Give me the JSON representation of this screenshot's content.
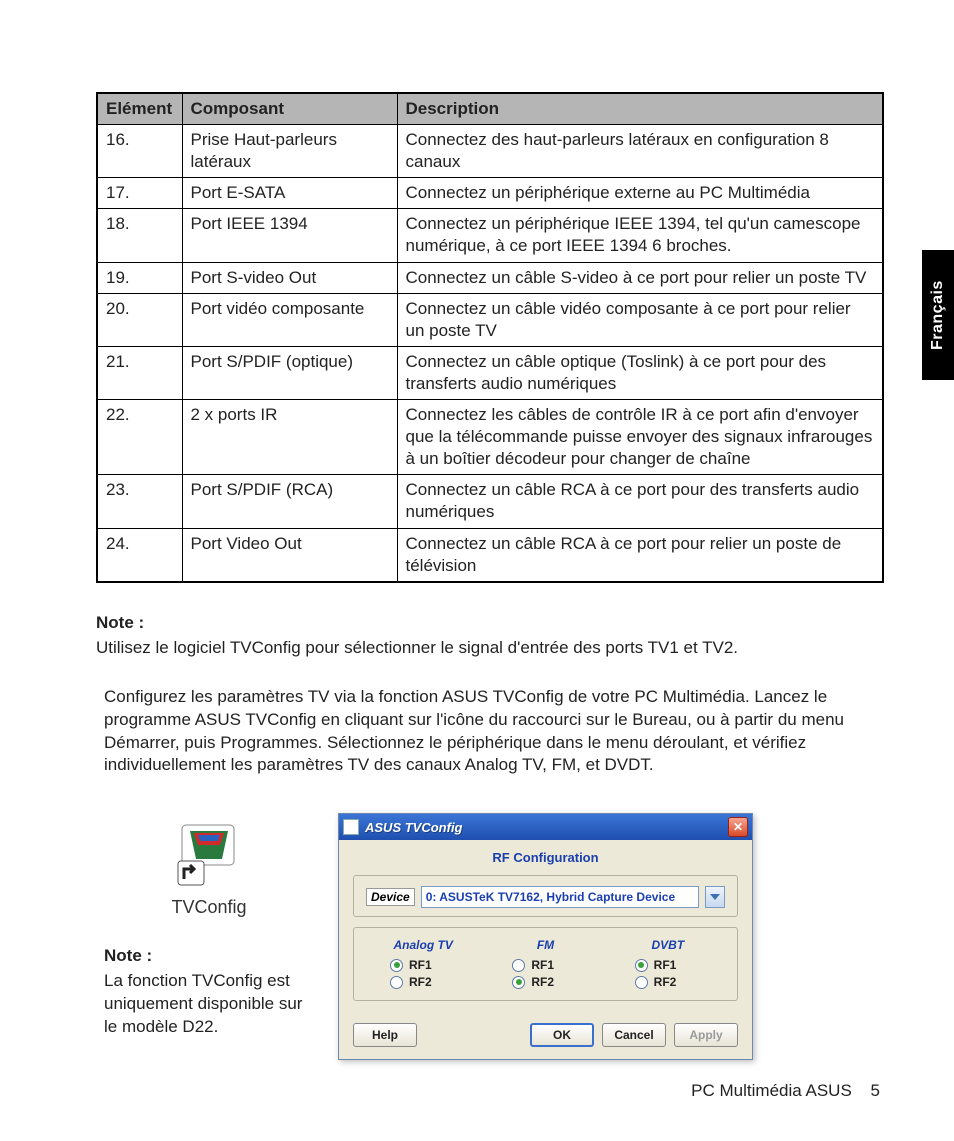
{
  "sideTab": "Français",
  "table": {
    "headers": {
      "c1": "Elément",
      "c2": "Composant",
      "c3": "Description"
    },
    "rows": [
      {
        "n": "16.",
        "comp": "Prise Haut-parleurs latéraux",
        "desc": "Connectez des haut-parleurs latéraux en configuration 8 canaux"
      },
      {
        "n": "17.",
        "comp": "Port E-SATA",
        "desc": "Connectez un périphérique externe au PC Multimédia"
      },
      {
        "n": "18.",
        "comp": "Port IEEE 1394",
        "desc": "Connectez un périphérique IEEE 1394, tel qu'un camescope numérique,  à ce port IEEE 1394 6 broches."
      },
      {
        "n": "19.",
        "comp": "Port S-video Out",
        "desc": "Connectez un câble S-video à ce port pour relier un poste TV"
      },
      {
        "n": "20.",
        "comp": "Port vidéo composante",
        "desc": "Connectez un câble vidéo composante à ce port pour relier un poste TV"
      },
      {
        "n": "21.",
        "comp": "Port S/PDIF (optique)",
        "desc": "Connectez un câble optique (Toslink) à ce port pour des transferts audio numériques"
      },
      {
        "n": "22.",
        "comp": "2 x ports IR",
        "desc": "Connectez les câbles de contrôle IR à ce port afin d'envoyer que la télécommande puisse envoyer des signaux infrarouges à un boîtier décodeur pour changer de chaîne"
      },
      {
        "n": "23.",
        "comp": "Port S/PDIF (RCA)",
        "desc": "Connectez un câble RCA  à ce port pour des transferts audio numériques"
      },
      {
        "n": "24.",
        "comp": "Port Video Out",
        "desc": "Connectez un câble RCA à ce port pour relier un poste de télévision"
      }
    ]
  },
  "note1": {
    "label": "Note :",
    "text": "Utilisez le logiciel  TVConfig pour sélectionner le signal d'entrée des ports TV1 et TV2."
  },
  "paragraph": "Configurez les paramètres TV via la fonction ASUS TVConfig de votre PC Multimédia.  Lancez le programme ASUS TVConfig en cliquant sur l'icône du raccourci sur le Bureau, ou à partir du menu Démarrer, puis Programmes.  Sélectionnez le périphérique dans le menu déroulant, et vérifiez individuellement les  paramètres TV des canaux Analog TV, FM, et DVDT.",
  "iconLabel": "TVConfig",
  "note2": {
    "label": "Note :",
    "text": "La fonction TVConfig est uniquement disponible sur le modèle D22."
  },
  "dialog": {
    "title": "ASUS TVConfig",
    "sectionTitle": "RF  Configuration",
    "deviceLabel": "Device",
    "deviceValue": "0: ASUSTeK TV7162, Hybrid Capture Device",
    "columns": [
      {
        "head": "Analog TV",
        "rf1": true,
        "rf2": false
      },
      {
        "head": "FM",
        "rf1": false,
        "rf2": true
      },
      {
        "head": "DVBT",
        "rf1": true,
        "rf2": false
      }
    ],
    "rfLabels": {
      "rf1": "RF1",
      "rf2": "RF2"
    },
    "buttons": {
      "help": "Help",
      "ok": "OK",
      "cancel": "Cancel",
      "apply": "Apply"
    }
  },
  "footer": {
    "title": "PC Multimédia ASUS",
    "page": "5"
  }
}
